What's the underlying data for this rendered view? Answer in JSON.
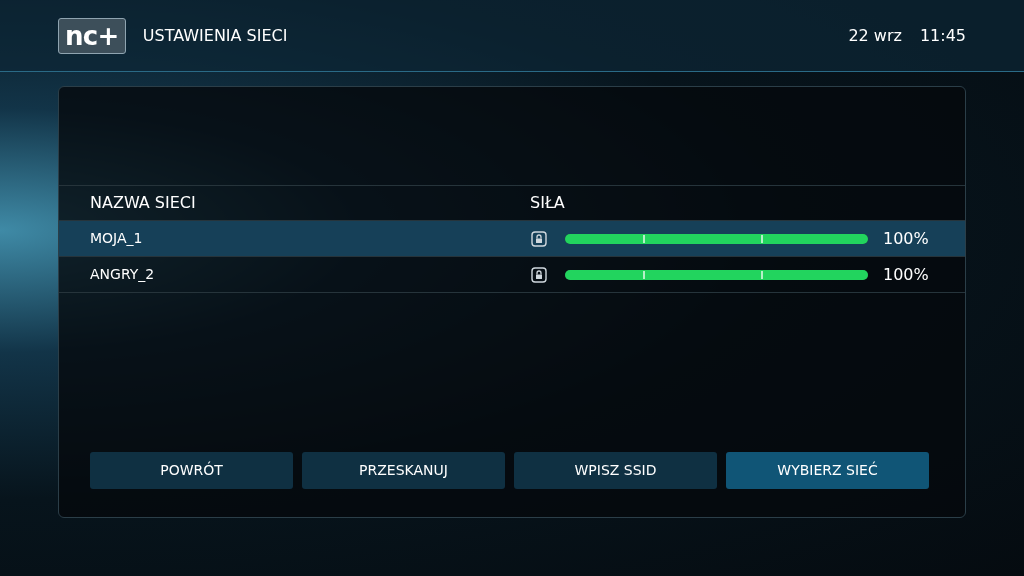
{
  "header": {
    "logo": "nc+",
    "title": "USTAWIENIA SIECI",
    "date": "22 wrz",
    "time": "11:45"
  },
  "table": {
    "columns": [
      "NAZWA SIECI",
      "SIŁA"
    ],
    "rows": [
      {
        "name": "MOJA_1",
        "locked": true,
        "level": 1,
        "reading": "100%",
        "selected": true
      },
      {
        "name": "ANGRY_2",
        "locked": true,
        "level": 1,
        "reading": "100%",
        "selected": false
      }
    ]
  },
  "buttons": [
    {
      "label": "POWRÓT",
      "selected": false
    },
    {
      "label": "PRZESKANUJ",
      "selected": false
    },
    {
      "label": "WPISZ SSID",
      "selected": false
    },
    {
      "label": "WYBIERZ SIEĆ",
      "selected": true
    }
  ]
}
